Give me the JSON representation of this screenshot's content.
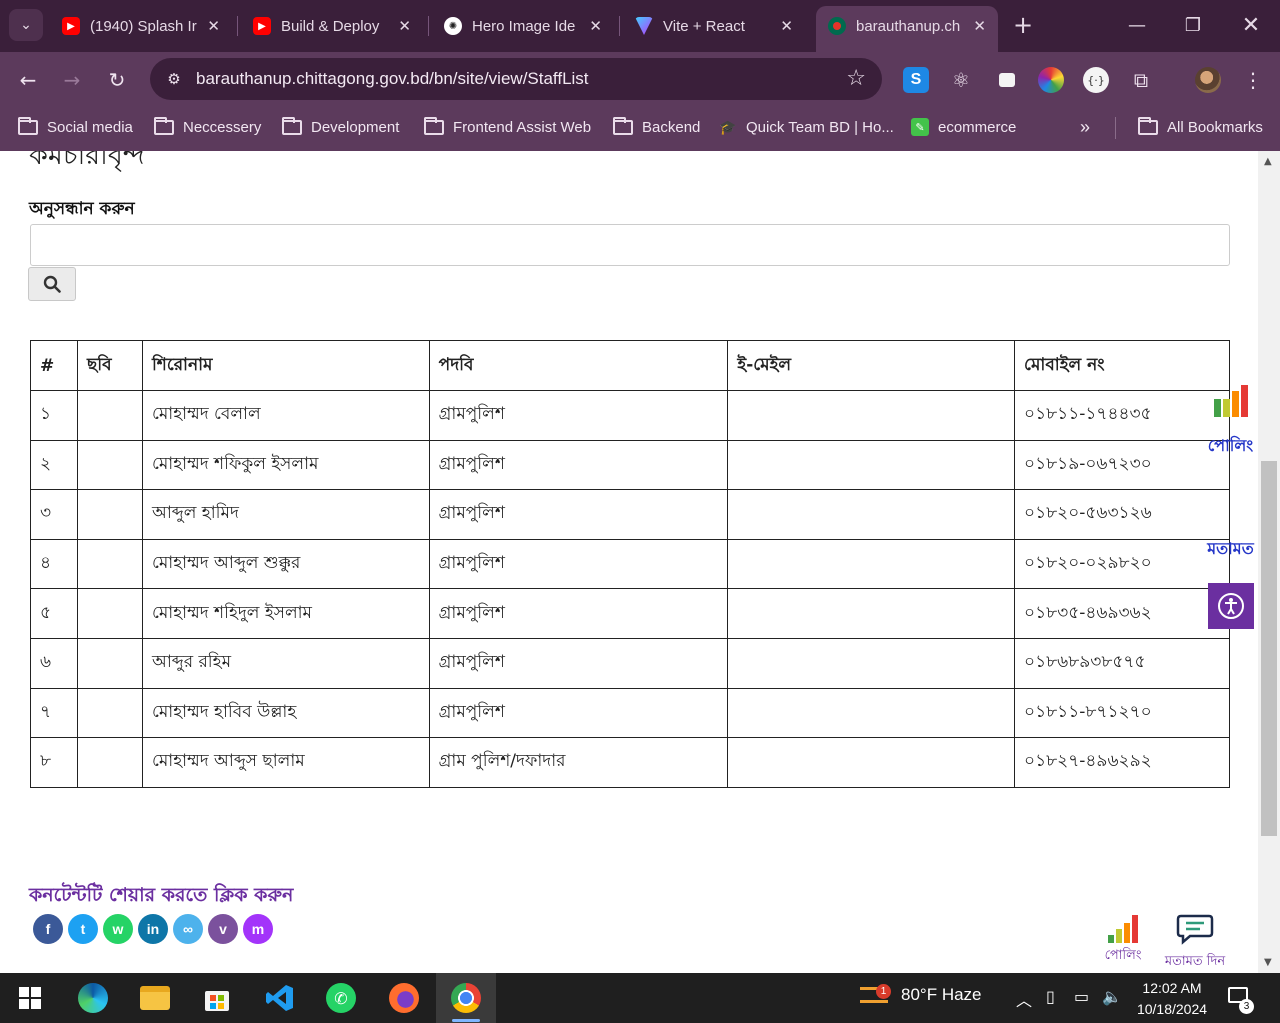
{
  "browser": {
    "tabs": [
      {
        "title": "(1940) Splash Ir",
        "favicon": "youtube-icon",
        "color": "#ff0000"
      },
      {
        "title": "Build & Deploy",
        "favicon": "youtube-icon",
        "color": "#ff0000"
      },
      {
        "title": "Hero Image Ide",
        "favicon": "chatgpt-icon",
        "color": "#ffffff"
      },
      {
        "title": "Vite + React",
        "favicon": "vite-icon",
        "color": "#a259ff"
      },
      {
        "title": "barauthanup.ch",
        "favicon": "bd-gov-icon",
        "color": "#e63329",
        "active": true
      }
    ],
    "new_tab_label": "+",
    "url": "barauthanup.chittagong.gov.bd/bn/site/view/StaffList",
    "bookmarks": [
      {
        "label": "Social media",
        "type": "folder"
      },
      {
        "label": "Neccessery",
        "type": "folder"
      },
      {
        "label": "Development",
        "type": "folder"
      },
      {
        "label": "Frontend Assist Web",
        "type": "folder"
      },
      {
        "label": "Backend",
        "type": "folder"
      },
      {
        "label": "Quick Team BD | Ho...",
        "type": "link"
      },
      {
        "label": "ecommerce",
        "type": "link"
      }
    ],
    "bookmarks_overflow": "»",
    "all_bookmarks": "All Bookmarks"
  },
  "page": {
    "heading": "কর্মচারীবৃন্দ",
    "search_label": "অনুসন্ধান করুন",
    "search_value": "",
    "table": {
      "headers": [
        "#",
        "ছবি",
        "শিরোনাম",
        "পদবি",
        "ই-মেইল",
        "মোবাইল নং"
      ],
      "rows": [
        [
          "১",
          "",
          "মোহাম্মদ বেলাল",
          "গ্রামপুলিশ",
          "",
          "০১৮১১-১৭৪৪৩৫"
        ],
        [
          "২",
          "",
          "মোহাম্মদ শফিকুল ইসলাম",
          "গ্রামপুলিশ",
          "",
          "০১৮১৯-০৬৭২৩০"
        ],
        [
          "৩",
          "",
          "আব্দুল হামিদ",
          "গ্রামপুলিশ",
          "",
          "০১৮২০-৫৬৩১২৬"
        ],
        [
          "৪",
          "",
          "মোহাম্মদ আব্দুল শুক্কুর",
          "গ্রামপুলিশ",
          "",
          "০১৮২০-০২৯৮২০"
        ],
        [
          "৫",
          "",
          "মোহাম্মদ শহিদুল ইসলাম",
          "গ্রামপুলিশ",
          "",
          "০১৮৩৫-৪৬৯৩৬২"
        ],
        [
          "৬",
          "",
          "আব্দুর রহিম",
          "গ্রামপুলিশ",
          "",
          "০১৮৬৮৯৩৮৫৭৫"
        ],
        [
          "৭",
          "",
          "মোহাম্মদ হাবিব উল্লাহ",
          "গ্রামপুলিশ",
          "",
          "০১৮১১-৮৭১২৭০"
        ],
        [
          "৮",
          "",
          "মোহাম্মদ আব্দুস ছালাম",
          "গ্রাম পুলিশ/দফাদার",
          "",
          "০১৮২৭-৪৯৬২৯২"
        ]
      ]
    },
    "share_title": "কনটেন্টটি শেয়ার করতে ক্লিক করুন",
    "share_buttons": [
      {
        "name": "facebook-icon",
        "glyph": "f",
        "color": "#3b5998"
      },
      {
        "name": "twitter-icon",
        "glyph": "t",
        "color": "#1da1f2"
      },
      {
        "name": "whatsapp-icon",
        "glyph": "w",
        "color": "#25d366"
      },
      {
        "name": "linkedin-icon",
        "glyph": "in",
        "color": "#0e76a8"
      },
      {
        "name": "copy-link-icon",
        "glyph": "∞",
        "color": "#4db2ec"
      },
      {
        "name": "viber-icon",
        "glyph": "v",
        "color": "#7b519d"
      },
      {
        "name": "messenger-icon",
        "glyph": "m",
        "color": "#a334fa"
      }
    ],
    "side_poll_label": "পোলিং",
    "side_opinion_label": "মতামত",
    "footer_poll_label": "পোলিং",
    "footer_opinion_label": "মতামত দিন",
    "accent_color": "#6b2fa0"
  },
  "taskbar": {
    "weather": "80°F  Haze",
    "weather_badge": "1",
    "time": "12:02 AM",
    "date": "10/18/2024",
    "notifications": "3"
  }
}
